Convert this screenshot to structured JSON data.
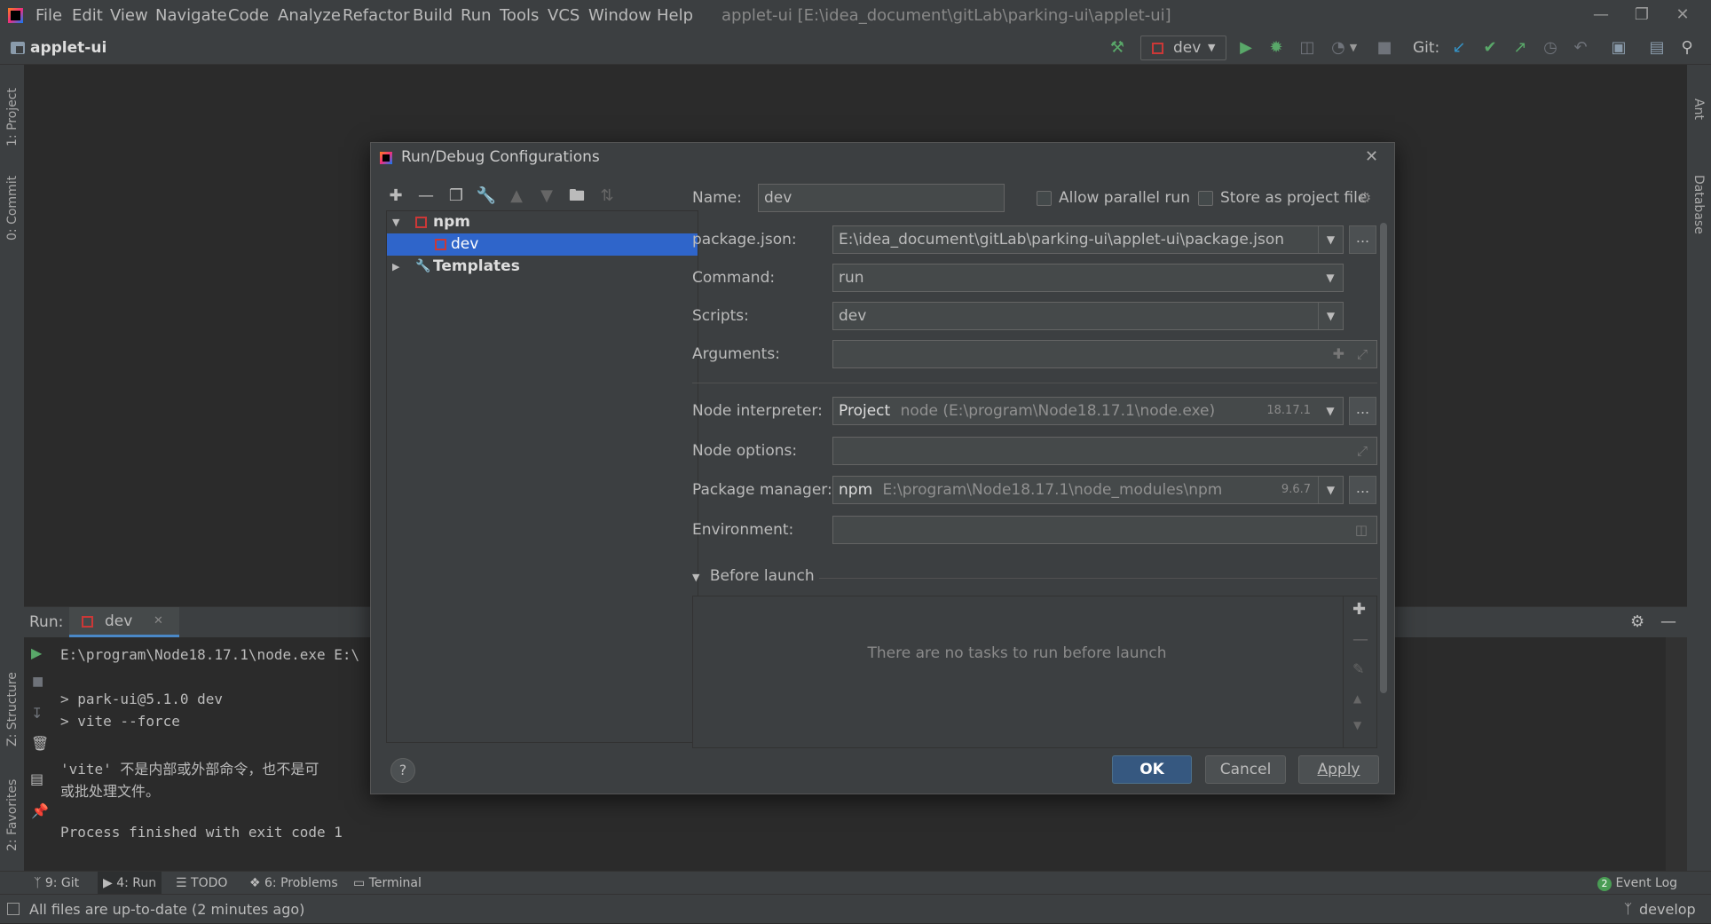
{
  "menu": {
    "items": [
      "File",
      "Edit",
      "View",
      "Navigate",
      "Code",
      "Analyze",
      "Refactor",
      "Build",
      "Run",
      "Tools",
      "VCS",
      "Window",
      "Help"
    ],
    "window_title": "applet-ui [E:\\idea_document\\gitLab\\parking-ui\\applet-ui]"
  },
  "navbar": {
    "project_name": "applet-ui",
    "run_config": "dev",
    "git_label": "Git:"
  },
  "left_strip": {
    "project_tab": "1: Project",
    "commit_tab": "0: Commit",
    "structure_tab": "Z: Structure",
    "favorites_tab": "2: Favorites"
  },
  "right_strip": {
    "ant_tab": "Ant",
    "database_tab": "Database"
  },
  "run_panel": {
    "label": "Run:",
    "tab": "dev",
    "console": [
      "E:\\program\\Node18.17.1\\node.exe E:\\",
      "",
      "> park-ui@5.1.0 dev",
      "> vite --force",
      "",
      "'vite' 不是内部或外部命令，也不是可",
      "或批处理文件。",
      "",
      "Process finished with exit code 1"
    ]
  },
  "bottom_tabs": {
    "git": "9: Git",
    "run": "4: Run",
    "todo": "TODO",
    "problems": "6: Problems",
    "terminal": "Terminal",
    "event_log": "Event Log",
    "event_count": "2"
  },
  "status": {
    "message": "All files are up-to-date (2 minutes ago)",
    "branch": "develop"
  },
  "dialog": {
    "title": "Run/Debug Configurations",
    "tree": {
      "npm": "npm",
      "dev": "dev",
      "templates": "Templates"
    },
    "fields": {
      "name_label": "Name:",
      "name_value": "dev",
      "allow_parallel": "Allow parallel run",
      "store_project": "Store as project file",
      "package_json_label": "package.json:",
      "package_json_value": "E:\\idea_document\\gitLab\\parking-ui\\applet-ui\\package.json",
      "command_label": "Command:",
      "command_value": "run",
      "scripts_label": "Scripts:",
      "scripts_value": "dev",
      "arguments_label": "Arguments:",
      "arguments_value": "",
      "node_interpreter_label": "Node interpreter:",
      "node_interpreter_prefix": "Project",
      "node_interpreter_value": "node (E:\\program\\Node18.17.1\\node.exe)",
      "node_version": "18.17.1",
      "node_options_label": "Node options:",
      "node_options_value": "",
      "package_manager_label": "Package manager:",
      "package_manager_prefix": "npm",
      "package_manager_value": "E:\\program\\Node18.17.1\\node_modules\\npm",
      "npm_version": "9.6.7",
      "environment_label": "Environment:",
      "environment_value": ""
    },
    "before_launch": {
      "title": "Before launch",
      "empty": "There are no tasks to run before launch"
    },
    "buttons": {
      "ok": "OK",
      "cancel": "Cancel",
      "apply": "Apply",
      "help": "?",
      "ellipsis": "..."
    }
  },
  "colors": {
    "background": "#2b2b2b",
    "panel": "#3c3f41",
    "selection": "#2f65ca",
    "primary_button": "#365880",
    "run_green": "#59a869",
    "npm_red": "#cb3837"
  }
}
